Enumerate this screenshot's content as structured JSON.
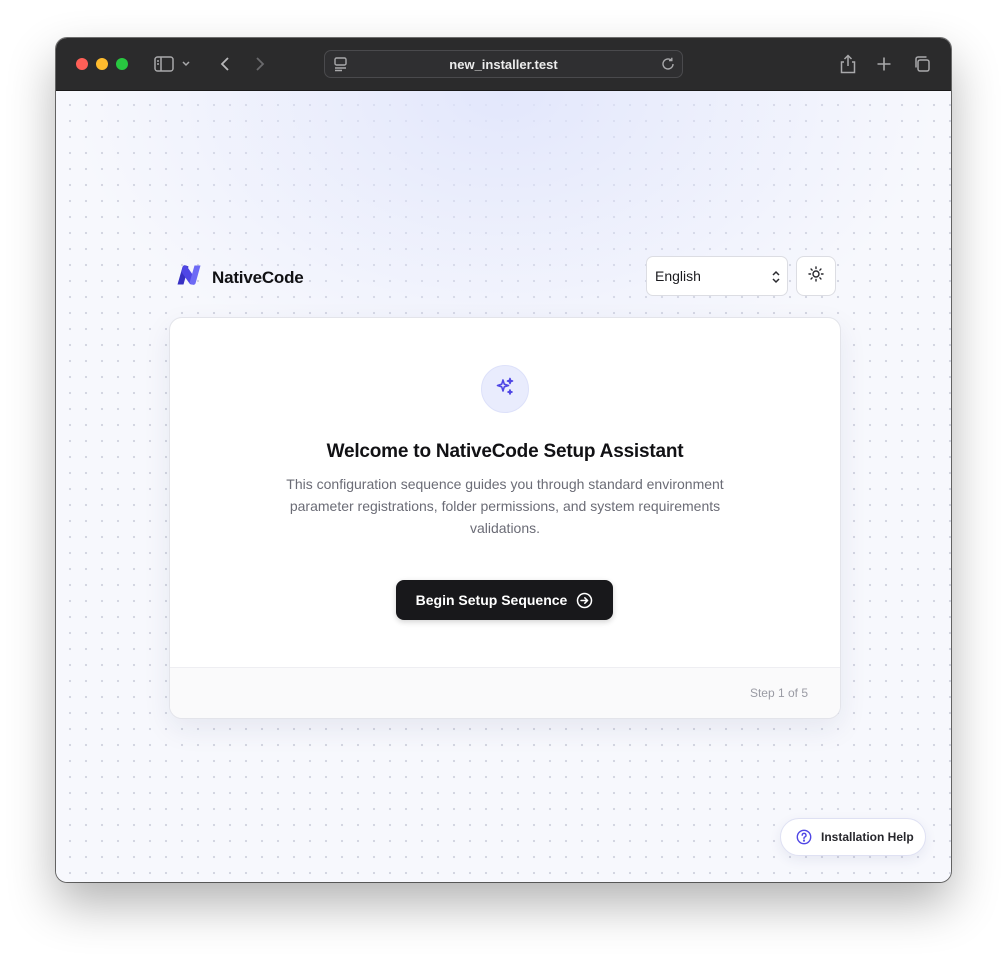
{
  "browser": {
    "url": "new_installer.test"
  },
  "header": {
    "brand_name": "NativeCode",
    "language": {
      "selected": "English"
    }
  },
  "card": {
    "title": "Welcome to NativeCode Setup Assistant",
    "description": "This configuration sequence guides you through standard environment parameter registrations, folder permissions, and system requirements validations.",
    "begin_label": "Begin Setup Sequence",
    "step_text": "Step 1 of 5"
  },
  "help": {
    "label": "Installation Help"
  },
  "icons": {
    "logo": "nativecode-logo-icon",
    "theme": "sun-icon",
    "feature": "sparkles-icon",
    "begin": "arrow-right-circle-icon",
    "help": "question-circle-icon"
  },
  "colors": {
    "accent": "#4f46e5",
    "logo_dark": "#3730c4",
    "logo_light": "#6d6af5",
    "primary_button": "#18181b",
    "page_background": "#f7f8fd"
  }
}
